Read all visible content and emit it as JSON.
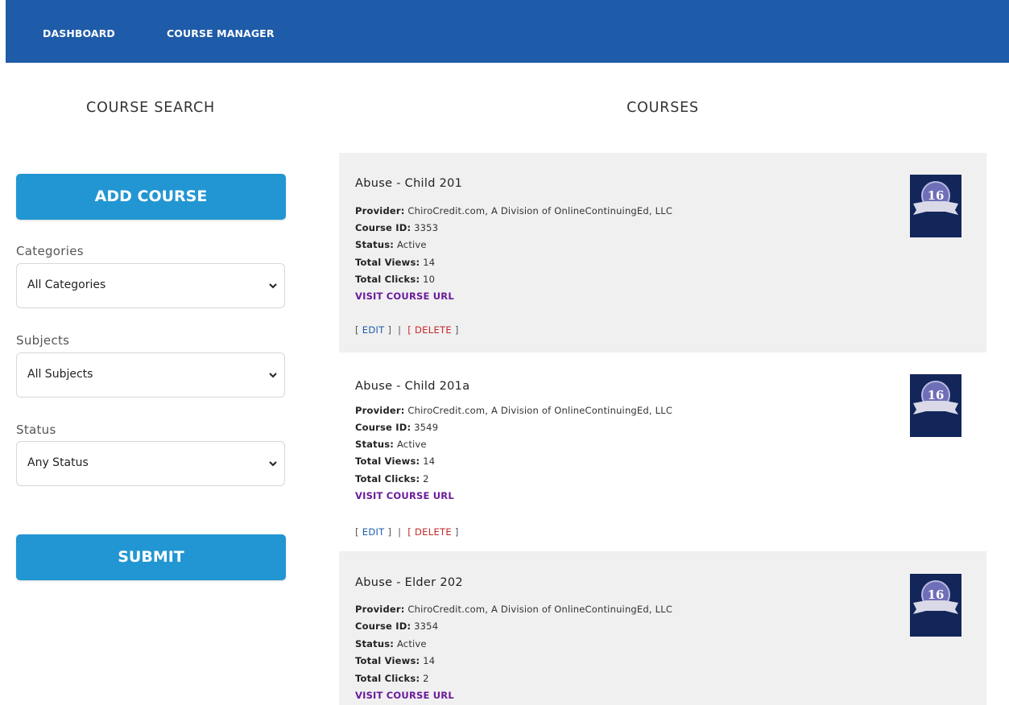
{
  "nav": {
    "dashboard": "DASHBOARD",
    "course_manager": "COURSE MANAGER"
  },
  "sidebar": {
    "heading": "COURSE SEARCH",
    "add_course": "ADD COURSE",
    "categories_label": "Categories",
    "categories_value": "All Categories",
    "subjects_label": "Subjects",
    "subjects_value": "All Subjects",
    "status_label": "Status",
    "status_value": "Any Status",
    "submit": "SUBMIT"
  },
  "main": {
    "heading": "COURSES",
    "field_labels": {
      "provider": "Provider:",
      "course_id": "Course ID:",
      "status": "Status:",
      "views": "Total Views:",
      "clicks": "Total Clicks:"
    },
    "visit_label": "VISIT COURSE URL",
    "edit_label": "EDIT",
    "delete_label": "DELETE",
    "courses": [
      {
        "title": "Abuse - Child 201",
        "provider": "ChiroCredit.com, A Division of OnlineContinuingEd, LLC",
        "course_id": "3353",
        "status": "Active",
        "views": "14",
        "clicks": "10",
        "badge": "16"
      },
      {
        "title": "Abuse - Child 201a",
        "provider": "ChiroCredit.com, A Division of OnlineContinuingEd, LLC",
        "course_id": "3549",
        "status": "Active",
        "views": "14",
        "clicks": "2",
        "badge": "16"
      },
      {
        "title": "Abuse - Elder 202",
        "provider": "ChiroCredit.com, A Division of OnlineContinuingEd, LLC",
        "course_id": "3354",
        "status": "Active",
        "views": "14",
        "clicks": "2",
        "badge": "16"
      }
    ]
  },
  "colors": {
    "nav_bg": "#1e5ba8",
    "button_bg": "#2296d2",
    "card_bg": "#f0f0f0",
    "visit_link": "#6a1b9a",
    "edit_link": "#1e5ba8",
    "delete_link": "#c62828"
  }
}
